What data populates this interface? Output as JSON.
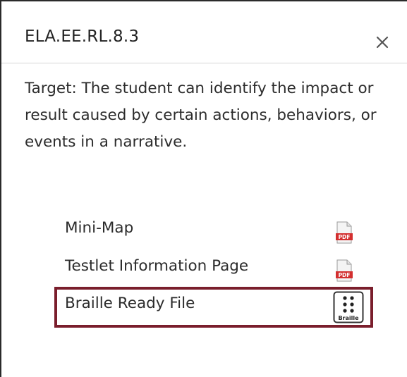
{
  "dialog": {
    "title": "ELA.EE.RL.8.3",
    "close_icon": "close-icon",
    "target_text": "Target: The student can identify the impact or result caused by certain actions, behaviors, or events in a narrative."
  },
  "links": [
    {
      "label": "Mini-Map",
      "icon": "pdf-icon"
    },
    {
      "label": "Testlet Information Page",
      "icon": "pdf-icon"
    },
    {
      "label": "Braille Ready File",
      "icon": "braille-icon",
      "icon_text": "Braille"
    }
  ],
  "colors": {
    "highlight_border": "#7a1e2c",
    "pdf_red": "#d32f2f"
  }
}
